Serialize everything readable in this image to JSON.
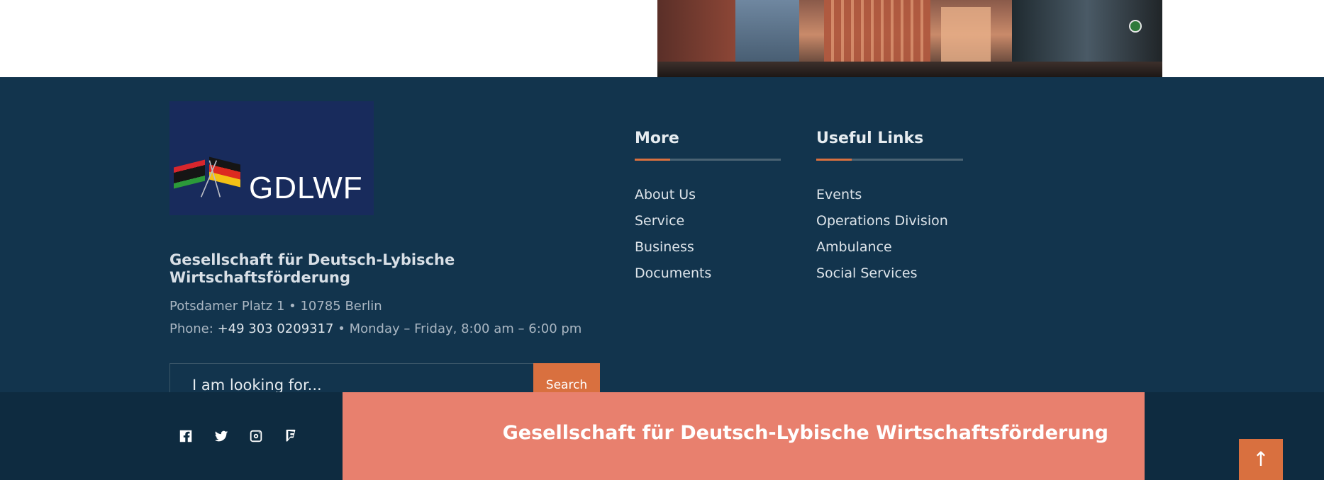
{
  "logo": {
    "text": "GDLWF",
    "icon": "libya-germany-flags-icon"
  },
  "org": {
    "name": "Gesellschaft für Deutsch-Lybische Wirtschaftsförderung",
    "address": "Potsdamer Platz 1 • 10785 Berlin",
    "phone_label": "Phone:",
    "phone_number": "+49 303 0209317",
    "hours": "• Monday – Friday, 8:00 am – 6:00 pm"
  },
  "search": {
    "placeholder": "I am looking for...",
    "button_label": "Search"
  },
  "more": {
    "title": "More",
    "links": [
      "About Us",
      "Service",
      "Business",
      "Documents"
    ]
  },
  "useful": {
    "title": "Useful Links",
    "links": [
      "Events",
      "Operations Division",
      "Ambulance",
      "Social Services"
    ]
  },
  "social": [
    "facebook-icon",
    "twitter-icon",
    "instagram-icon",
    "foursquare-icon"
  ],
  "bottom": {
    "title": "Gesellschaft für Deutsch-Lybische Wirtschaftsförderung",
    "to_top": "↑"
  },
  "colors": {
    "footer_bg": "#12344d",
    "accent": "#d9703f",
    "salmon": "#e8806e",
    "bottom_bg": "#0e2b40"
  }
}
